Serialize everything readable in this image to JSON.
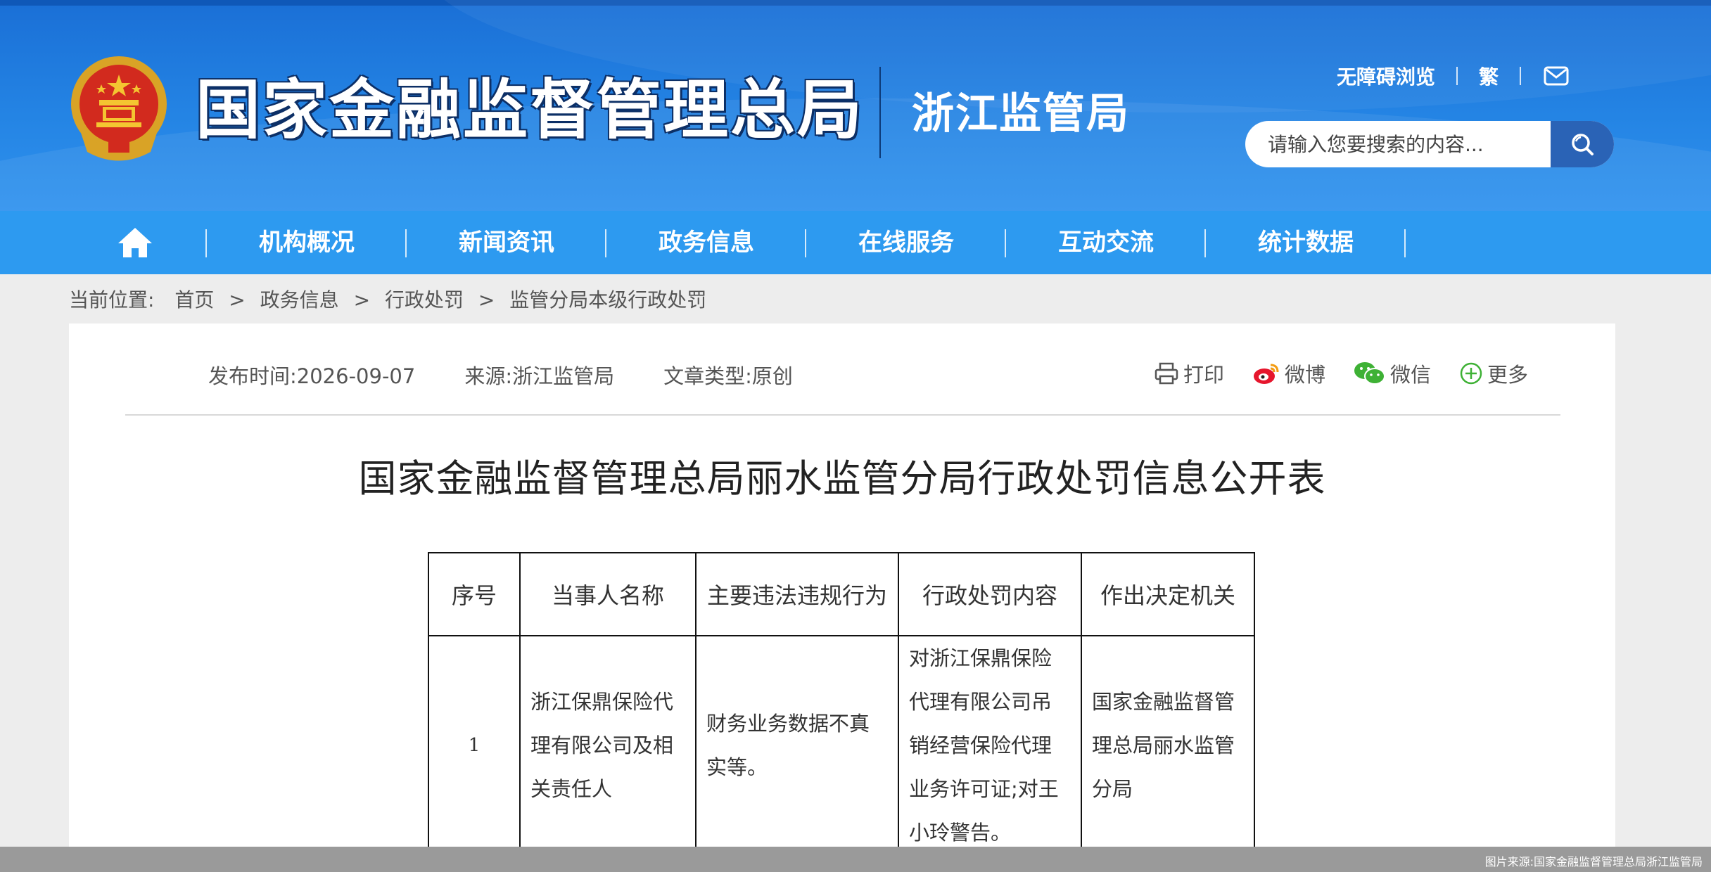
{
  "header": {
    "site_name": "国家金融监督管理总局",
    "sub_name": "浙江监管局",
    "links": {
      "accessible": "无障碍浏览",
      "traditional": "繁"
    },
    "search_placeholder": "请输入您要搜索的内容..."
  },
  "nav": {
    "items": [
      {
        "label": "机构概况"
      },
      {
        "label": "新闻资讯"
      },
      {
        "label": "政务信息"
      },
      {
        "label": "在线服务"
      },
      {
        "label": "互动交流"
      },
      {
        "label": "统计数据"
      }
    ]
  },
  "breadcrumb": {
    "label": "当前位置:",
    "items": [
      "首页",
      "政务信息",
      "行政处罚",
      "监管分局本级行政处罚"
    ],
    "separator": ">"
  },
  "article": {
    "publish_time": "发布时间:2026-09-07",
    "source": "来源:浙江监管局",
    "type": "文章类型:原创",
    "share": {
      "print": "打印",
      "weibo": "微博",
      "wechat": "微信",
      "more": "更多"
    },
    "title": "国家金融监督管理总局丽水监管分局行政处罚信息公开表"
  },
  "table": {
    "headers": [
      "序号",
      "当事人名称",
      "主要违法违规行为",
      "行政处罚内容",
      "作出决定机关"
    ],
    "rows": [
      {
        "no": "1",
        "party": "浙江保鼎保险代理有限公司及相关责任人",
        "violation": "财务业务数据不真实等。",
        "penalty": "对浙江保鼎保险代理有限公司吊销经营保险代理业务许可证;对王小玲警告。",
        "authority": "国家金融监督管理总局丽水监管分局"
      }
    ]
  },
  "footer": {
    "source_note": "图片来源:国家金融监督管理总局浙江监管局"
  },
  "colors": {
    "header_blue": "#1a6fd6",
    "nav_blue": "#2d9af0",
    "search_btn": "#2a63b6"
  }
}
